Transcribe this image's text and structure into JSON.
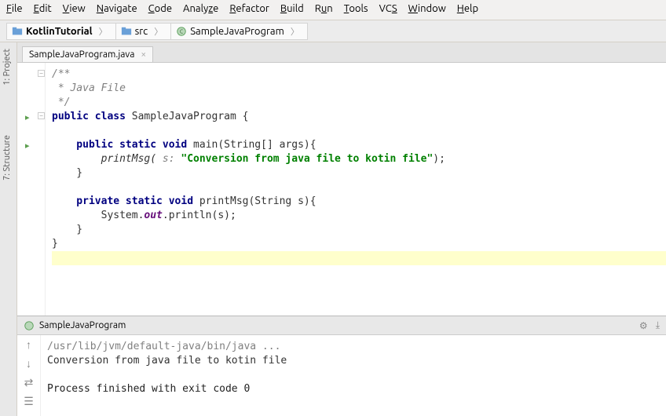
{
  "menu": {
    "file": "File",
    "edit": "Edit",
    "view": "View",
    "navigate": "Navigate",
    "code": "Code",
    "analyze": "Analyze",
    "refactor": "Refactor",
    "build": "Build",
    "run": "Run",
    "tools": "Tools",
    "vcs": "VCS",
    "window": "Window",
    "help": "Help"
  },
  "breadcrumb": {
    "project": "KotlinTutorial",
    "src": "src",
    "file": "SampleJavaProgram"
  },
  "sidetabs": {
    "project": "1: Project",
    "structure": "7: Structure"
  },
  "tab": {
    "name": "SampleJavaProgram.java"
  },
  "code": {
    "l1": "/**",
    "l2": " * Java File",
    "l3": " */",
    "l4a": "public",
    "l4b": " class",
    "l4c": " SampleJavaProgram {",
    "l6a": "    public",
    "l6b": " static",
    "l6c": " void",
    "l6d": " main(String[] args){",
    "l7a": "        printMsg(",
    "l7b": " s: ",
    "l7c": "\"Conversion from java file to kotin file\"",
    "l7d": ");",
    "l8": "    }",
    "l10a": "    private",
    "l10b": " static",
    "l10c": " void",
    "l10d": " printMsg(String s){",
    "l11a": "        System.",
    "l11b": "out",
    "l11c": ".println(s);",
    "l12": "    }",
    "l13": "}"
  },
  "run": {
    "title": "SampleJavaProgram",
    "path": "/usr/lib/jvm/default-java/bin/java ...",
    "out": "Conversion from java file to kotin file",
    "exit": "Process finished with exit code 0"
  }
}
